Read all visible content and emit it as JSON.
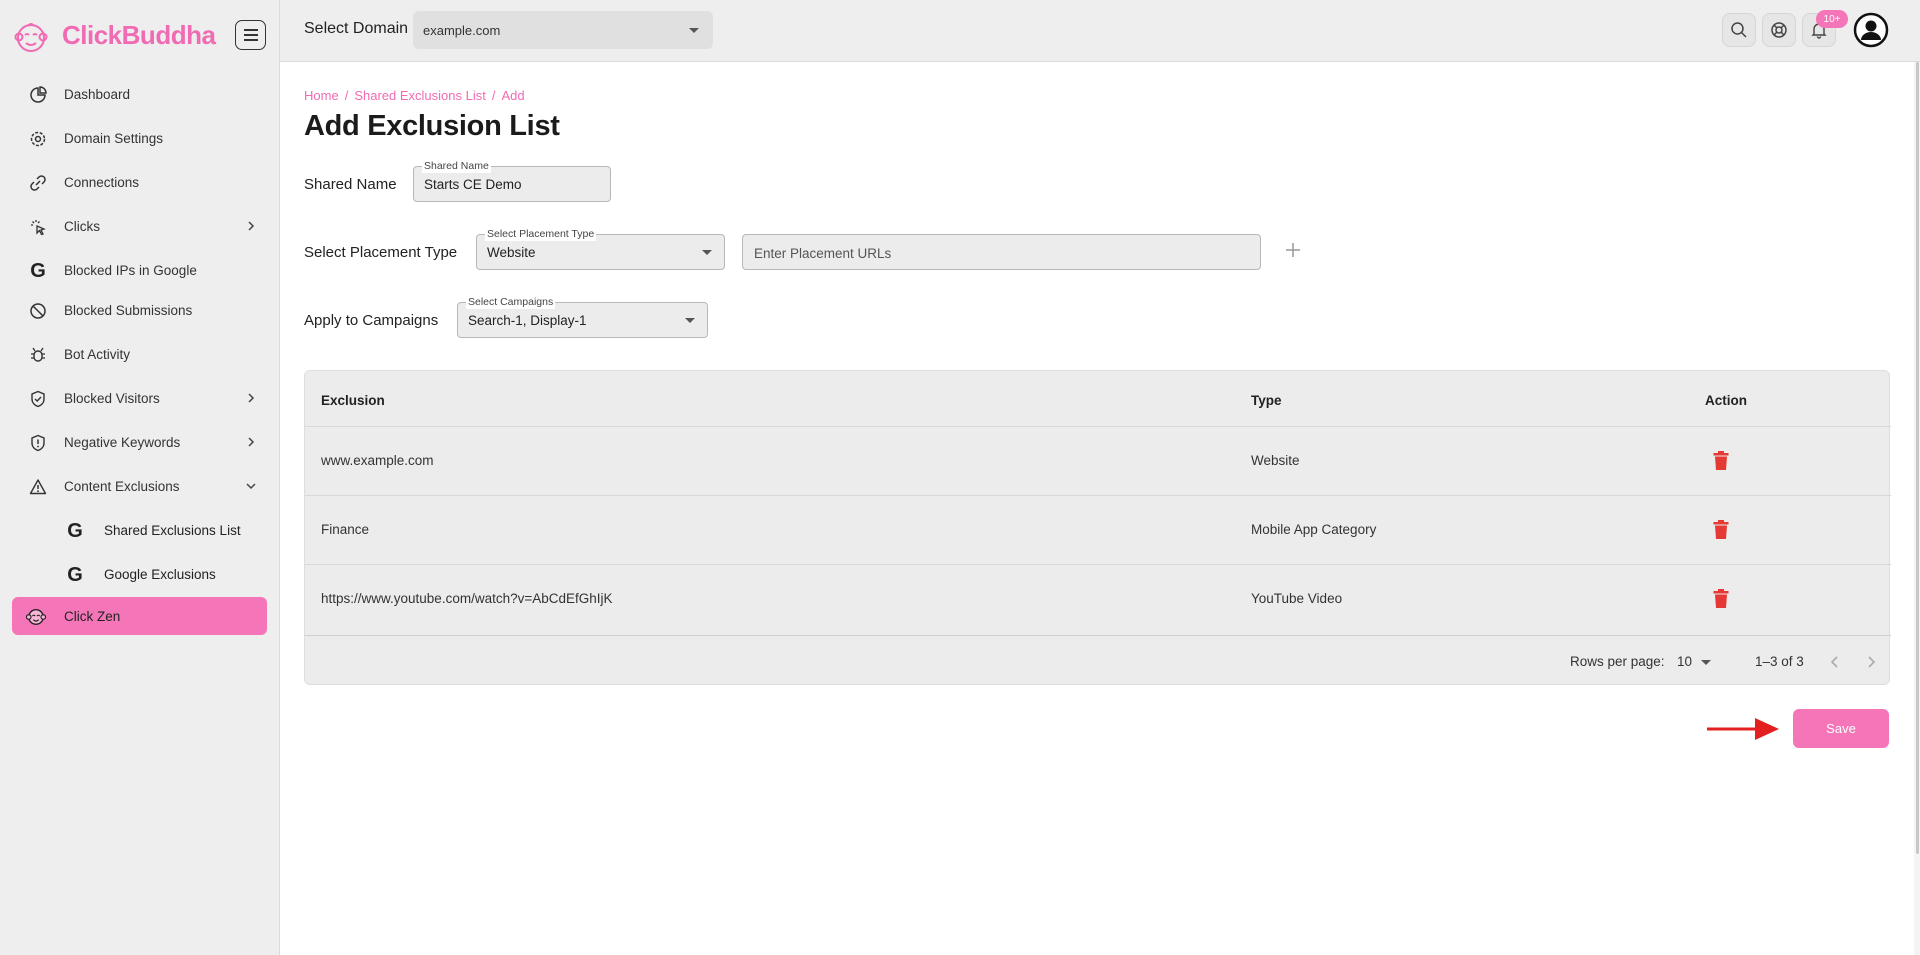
{
  "app": {
    "logo_click": "Click",
    "logo_buddha": "Buddha"
  },
  "topbar": {
    "domain_label": "Select Domain",
    "domain_value": "example.com",
    "notification_badge": "10+"
  },
  "sidebar": {
    "items": [
      {
        "label": "Dashboard",
        "icon": "dashboard-icon"
      },
      {
        "label": "Domain Settings",
        "icon": "gear-icon"
      },
      {
        "label": "Connections",
        "icon": "link-icon"
      },
      {
        "label": "Clicks",
        "icon": "click-icon",
        "expandable": true
      },
      {
        "label": "Blocked IPs in Google",
        "icon": "google-icon"
      },
      {
        "label": "Blocked Submissions",
        "icon": "ban-icon"
      },
      {
        "label": "Bot Activity",
        "icon": "bug-icon"
      },
      {
        "label": "Blocked Visitors",
        "icon": "shield-icon",
        "expandable": true
      },
      {
        "label": "Negative Keywords",
        "icon": "shield-alert-icon",
        "expandable": true
      },
      {
        "label": "Content Exclusions",
        "icon": "warning-icon",
        "expanded": true
      },
      {
        "label": "Shared Exclusions List",
        "icon": "google-icon",
        "sub": true
      },
      {
        "label": "Google Exclusions",
        "icon": "google-icon",
        "sub": true
      },
      {
        "label": "Click Zen",
        "icon": "monkey-icon",
        "active": true
      }
    ]
  },
  "breadcrumb": {
    "home": "Home",
    "list": "Shared Exclusions List",
    "current": "Add",
    "sep": "/"
  },
  "page": {
    "title": "Add Exclusion List"
  },
  "form": {
    "shared_name_label": "Shared Name",
    "shared_name_legend": "Shared Name",
    "shared_name_value": "Starts CE Demo",
    "placement_label": "Select Placement Type",
    "placement_legend": "Select Placement Type",
    "placement_value": "Website",
    "placement_urls_placeholder": "Enter Placement URLs",
    "campaigns_label": "Apply to Campaigns",
    "campaigns_legend": "Select Campaigns",
    "campaigns_value": "Search-1, Display-1"
  },
  "table": {
    "headers": [
      "Exclusion",
      "Type",
      "Action"
    ],
    "rows": [
      {
        "exclusion": "www.example.com",
        "type": "Website"
      },
      {
        "exclusion": "Finance",
        "type": "Mobile App Category"
      },
      {
        "exclusion": "https://www.youtube.com/watch?v=AbCdEfGhIjK",
        "type": "YouTube Video"
      }
    ],
    "rows_per_page_label": "Rows per page:",
    "rows_per_page_value": "10",
    "range_text": "1–3 of 3"
  },
  "actions": {
    "save_label": "Save"
  },
  "colors": {
    "brand_pink": "#f576b8",
    "delete_red": "#e53935"
  }
}
